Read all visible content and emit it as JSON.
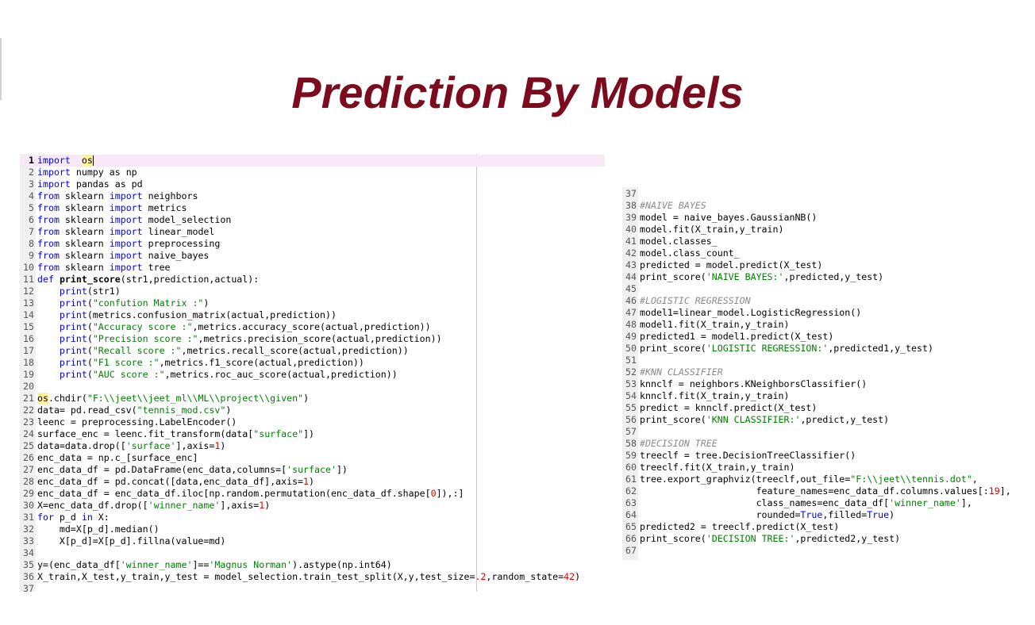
{
  "slide": {
    "title": "Prediction By Models"
  },
  "left_editor": {
    "lines": [
      {
        "n": "1",
        "t": [
          [
            "kw",
            "import"
          ],
          [
            "",
            "  "
          ],
          [
            "hl",
            "os"
          ]
        ],
        "current": true
      },
      {
        "n": "2",
        "t": [
          [
            "kw",
            "import"
          ],
          [
            "",
            " numpy as np"
          ]
        ]
      },
      {
        "n": "3",
        "t": [
          [
            "kw",
            "import"
          ],
          [
            "",
            " pandas as pd"
          ]
        ]
      },
      {
        "n": "4",
        "t": [
          [
            "kw",
            "from"
          ],
          [
            "",
            " sklearn "
          ],
          [
            "kw",
            "import"
          ],
          [
            "",
            " neighbors"
          ]
        ]
      },
      {
        "n": "5",
        "t": [
          [
            "kw",
            "from"
          ],
          [
            "",
            " sklearn "
          ],
          [
            "kw",
            "import"
          ],
          [
            "",
            " metrics"
          ]
        ]
      },
      {
        "n": "6",
        "t": [
          [
            "kw",
            "from"
          ],
          [
            "",
            " sklearn "
          ],
          [
            "kw",
            "import"
          ],
          [
            "",
            " model_selection"
          ]
        ]
      },
      {
        "n": "7",
        "t": [
          [
            "kw",
            "from"
          ],
          [
            "",
            " sklearn "
          ],
          [
            "kw",
            "import"
          ],
          [
            "",
            " linear_model"
          ]
        ]
      },
      {
        "n": "8",
        "t": [
          [
            "kw",
            "from"
          ],
          [
            "",
            " sklearn "
          ],
          [
            "kw",
            "import"
          ],
          [
            "",
            " preprocessing"
          ]
        ]
      },
      {
        "n": "9",
        "t": [
          [
            "kw",
            "from"
          ],
          [
            "",
            " sklearn "
          ],
          [
            "kw",
            "import"
          ],
          [
            "",
            " naive_bayes"
          ]
        ]
      },
      {
        "n": "10",
        "t": [
          [
            "kw",
            "from"
          ],
          [
            "",
            " sklearn "
          ],
          [
            "kw",
            "import"
          ],
          [
            "",
            " tree"
          ]
        ]
      },
      {
        "n": "11",
        "t": [
          [
            "kw",
            "def"
          ],
          [
            "",
            " "
          ],
          [
            "df",
            "print_score"
          ],
          [
            "",
            "(str1,prediction,actual):"
          ]
        ]
      },
      {
        "n": "12",
        "t": [
          [
            "",
            "    "
          ],
          [
            "kw",
            "print"
          ],
          [
            "",
            "(str1)"
          ]
        ]
      },
      {
        "n": "13",
        "t": [
          [
            "",
            "    "
          ],
          [
            "kw",
            "print"
          ],
          [
            "",
            "("
          ],
          [
            "st",
            "\"confution Matrix :\""
          ],
          [
            "",
            ")"
          ]
        ]
      },
      {
        "n": "14",
        "t": [
          [
            "",
            "    "
          ],
          [
            "kw",
            "print"
          ],
          [
            "",
            "(metrics.confusion_matrix(actual,prediction))"
          ]
        ]
      },
      {
        "n": "15",
        "t": [
          [
            "",
            "    "
          ],
          [
            "kw",
            "print"
          ],
          [
            "",
            "("
          ],
          [
            "st",
            "\"Accuracy score :\""
          ],
          [
            "",
            ",metrics.accuracy_score(actual,prediction))"
          ]
        ]
      },
      {
        "n": "16",
        "t": [
          [
            "",
            "    "
          ],
          [
            "kw",
            "print"
          ],
          [
            "",
            "("
          ],
          [
            "st",
            "\"Precision score :\""
          ],
          [
            "",
            ",metrics.precision_score(actual,prediction))"
          ]
        ]
      },
      {
        "n": "17",
        "t": [
          [
            "",
            "    "
          ],
          [
            "kw",
            "print"
          ],
          [
            "",
            "("
          ],
          [
            "st",
            "\"Recall score :\""
          ],
          [
            "",
            ",metrics.recall_score(actual,prediction))"
          ]
        ]
      },
      {
        "n": "18",
        "t": [
          [
            "",
            "    "
          ],
          [
            "kw",
            "print"
          ],
          [
            "",
            "("
          ],
          [
            "st",
            "\"F1 score :\""
          ],
          [
            "",
            ",metrics.f1_score(actual,prediction))"
          ]
        ]
      },
      {
        "n": "19",
        "t": [
          [
            "",
            "    "
          ],
          [
            "kw",
            "print"
          ],
          [
            "",
            "("
          ],
          [
            "st",
            "\"AUC score :\""
          ],
          [
            "",
            ",metrics.roc_auc_score(actual,prediction))"
          ]
        ]
      },
      {
        "n": "20",
        "t": []
      },
      {
        "n": "21",
        "t": [
          [
            "hl",
            "os"
          ],
          [
            "",
            ".chdir("
          ],
          [
            "st",
            "\"F:\\\\jeet\\\\jeet_ml\\\\ML\\\\project\\\\given\""
          ],
          [
            "",
            ")"
          ]
        ]
      },
      {
        "n": "22",
        "t": [
          [
            "",
            "data= pd.read_csv("
          ],
          [
            "st",
            "\"tennis_mod.csv\""
          ],
          [
            "",
            ")"
          ]
        ]
      },
      {
        "n": "23",
        "t": [
          [
            "",
            "leenc = preprocessing.LabelEncoder()"
          ]
        ]
      },
      {
        "n": "24",
        "t": [
          [
            "",
            "surface_enc = leenc.fit_transform(data["
          ],
          [
            "st",
            "\"surface\""
          ],
          [
            "",
            "])"
          ]
        ]
      },
      {
        "n": "25",
        "t": [
          [
            "",
            "data=data.drop(["
          ],
          [
            "st",
            "'surface'"
          ],
          [
            "",
            "],axis="
          ],
          [
            "nu",
            "1"
          ],
          [
            "",
            ")"
          ]
        ]
      },
      {
        "n": "26",
        "t": [
          [
            "",
            "enc_data = np.c_[surface_enc]"
          ]
        ]
      },
      {
        "n": "27",
        "t": [
          [
            "",
            "enc_data_df = pd.DataFrame(enc_data,columns=["
          ],
          [
            "st",
            "'surface'"
          ],
          [
            "",
            "])"
          ]
        ]
      },
      {
        "n": "28",
        "t": [
          [
            "",
            "enc_data_df = pd.concat([data,enc_data_df],axis="
          ],
          [
            "nu",
            "1"
          ],
          [
            "",
            ")"
          ]
        ]
      },
      {
        "n": "29",
        "t": [
          [
            "",
            "enc_data_df = enc_data_df.iloc[np.random.permutation(enc_data_df.shape["
          ],
          [
            "nu",
            "0"
          ],
          [
            "",
            "]),:]"
          ]
        ]
      },
      {
        "n": "30",
        "t": [
          [
            "",
            "X=enc_data_df.drop(["
          ],
          [
            "st",
            "'winner_name'"
          ],
          [
            "",
            "],axis="
          ],
          [
            "nu",
            "1"
          ],
          [
            "",
            ")"
          ]
        ]
      },
      {
        "n": "31",
        "t": [
          [
            "kw",
            "for"
          ],
          [
            "",
            " p_d "
          ],
          [
            "kw",
            "in"
          ],
          [
            "",
            " X:"
          ]
        ]
      },
      {
        "n": "32",
        "t": [
          [
            "",
            "    md=X[p_d].median()"
          ]
        ]
      },
      {
        "n": "33",
        "t": [
          [
            "",
            "    X[p_d]=X[p_d].fillna(value=md)"
          ]
        ]
      },
      {
        "n": "34",
        "t": []
      },
      {
        "n": "35",
        "t": [
          [
            "",
            "y=(enc_data_df["
          ],
          [
            "st",
            "'winner_name'"
          ],
          [
            "",
            "]=="
          ],
          [
            "st",
            "'Magnus Norman'"
          ],
          [
            "",
            ").astype(np.int64)"
          ]
        ]
      },
      {
        "n": "36",
        "t": [
          [
            "",
            "X_train,X_test,y_train,y_test = model_selection.train_test_split(X,y,test_size="
          ],
          [
            "nu",
            ".2"
          ],
          [
            "",
            ",random_state="
          ],
          [
            "nu",
            "42"
          ],
          [
            "",
            ")"
          ]
        ]
      },
      {
        "n": "37",
        "t": []
      }
    ]
  },
  "right_editor": {
    "lines": [
      {
        "n": "37",
        "t": []
      },
      {
        "n": "38",
        "t": [
          [
            "cm",
            "#NAIVE BAYES"
          ]
        ]
      },
      {
        "n": "39",
        "t": [
          [
            "",
            "model = naive_bayes.GaussianNB()"
          ]
        ]
      },
      {
        "n": "40",
        "t": [
          [
            "",
            "model.fit(X_train,y_train)"
          ]
        ]
      },
      {
        "n": "41",
        "t": [
          [
            "",
            "model.classes_"
          ]
        ]
      },
      {
        "n": "42",
        "t": [
          [
            "",
            "model.class_count_"
          ]
        ]
      },
      {
        "n": "43",
        "t": [
          [
            "",
            "predicted = model.predict(X_test)"
          ]
        ]
      },
      {
        "n": "44",
        "t": [
          [
            "",
            "print_score("
          ],
          [
            "st",
            "'NAIVE BAYES:'"
          ],
          [
            "",
            ",predicted,y_test)"
          ]
        ]
      },
      {
        "n": "45",
        "t": []
      },
      {
        "n": "46",
        "t": [
          [
            "cm",
            "#LOGISTIC REGRESSION"
          ]
        ]
      },
      {
        "n": "47",
        "t": [
          [
            "",
            "model1=linear_model.LogisticRegression()"
          ]
        ]
      },
      {
        "n": "48",
        "t": [
          [
            "",
            "model1.fit(X_train,y_train)"
          ]
        ]
      },
      {
        "n": "49",
        "t": [
          [
            "",
            "predicted1 = model1.predict(X_test)"
          ]
        ]
      },
      {
        "n": "50",
        "t": [
          [
            "",
            "print_score("
          ],
          [
            "st",
            "'LOGISTIC REGRESSION:'"
          ],
          [
            "",
            ",predicted1,y_test)"
          ]
        ]
      },
      {
        "n": "51",
        "t": []
      },
      {
        "n": "52",
        "t": [
          [
            "cm",
            "#KNN CLASSIFIER"
          ]
        ]
      },
      {
        "n": "53",
        "t": [
          [
            "",
            "knnclf = neighbors.KNeighborsClassifier()"
          ]
        ]
      },
      {
        "n": "54",
        "t": [
          [
            "",
            "knnclf.fit(X_train,y_train)"
          ]
        ]
      },
      {
        "n": "55",
        "t": [
          [
            "",
            "predict = knnclf.predict(X_test)"
          ]
        ]
      },
      {
        "n": "56",
        "t": [
          [
            "",
            "print_score("
          ],
          [
            "st",
            "'KNN CLASSIFIER:'"
          ],
          [
            "",
            ",predict,y_test)"
          ]
        ]
      },
      {
        "n": "57",
        "t": []
      },
      {
        "n": "58",
        "t": [
          [
            "cm",
            "#DECISION TREE"
          ]
        ]
      },
      {
        "n": "59",
        "t": [
          [
            "",
            "treeclf = tree.DecisionTreeClassifier()"
          ]
        ]
      },
      {
        "n": "60",
        "t": [
          [
            "",
            "treeclf.fit(X_train,y_train)"
          ]
        ]
      },
      {
        "n": "61",
        "t": [
          [
            "",
            "tree.export_graphviz(treeclf,out_file="
          ],
          [
            "st",
            "\"F:\\\\jeet\\\\tennis.dot\""
          ],
          [
            "",
            ","
          ]
        ]
      },
      {
        "n": "62",
        "t": [
          [
            "",
            "                     feature_names=enc_data_df.columns.values[:"
          ],
          [
            "nu",
            "19"
          ],
          [
            "",
            "],"
          ]
        ]
      },
      {
        "n": "63",
        "t": [
          [
            "",
            "                     class_names=enc_data_df["
          ],
          [
            "st",
            "'winner_name'"
          ],
          [
            "",
            "],"
          ]
        ]
      },
      {
        "n": "64",
        "t": [
          [
            "",
            "                     rounded="
          ],
          [
            "kw",
            "True"
          ],
          [
            "",
            ",filled="
          ],
          [
            "kw",
            "True"
          ],
          [
            "",
            ")"
          ]
        ]
      },
      {
        "n": "65",
        "t": [
          [
            "",
            "predicted2 = treeclf.predict(X_test)"
          ]
        ]
      },
      {
        "n": "66",
        "t": [
          [
            "",
            "print_score("
          ],
          [
            "st",
            "'DECISION TREE:'"
          ],
          [
            "",
            ",predicted2,y_test)"
          ]
        ]
      },
      {
        "n": "67",
        "t": []
      }
    ]
  }
}
